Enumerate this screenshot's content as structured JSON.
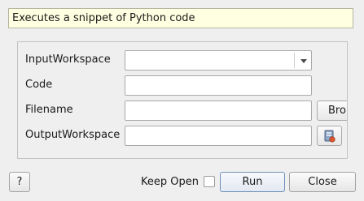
{
  "description": "Executes a snippet of Python code",
  "properties": [
    {
      "label": "InputWorkspace",
      "value": ""
    },
    {
      "label": "Code",
      "value": ""
    },
    {
      "label": "Filename",
      "value": ""
    },
    {
      "label": "OutputWorkspace",
      "value": ""
    }
  ],
  "browse_label": "Bro",
  "icons": {
    "combo_arrow": "chevron-down-icon",
    "workspace_picker": "workspace-icon"
  },
  "footer": {
    "help_label": "?",
    "keep_open_label": "Keep Open",
    "keep_open_checked": false,
    "run_label": "Run",
    "close_label": "Close"
  }
}
